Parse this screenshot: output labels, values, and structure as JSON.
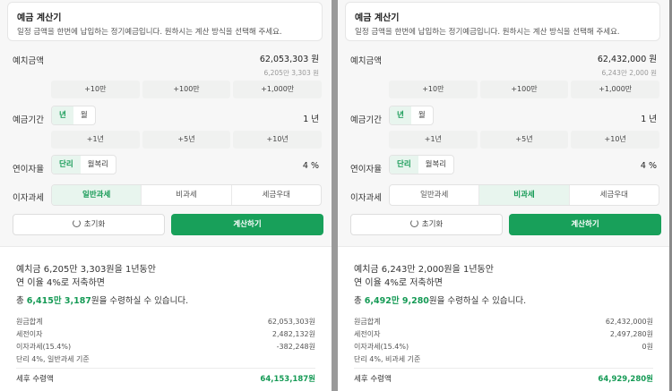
{
  "panels": [
    {
      "title": "예금 계산기",
      "subtitle": "일정 금액을 한번에 납입하는 정기예금입니다. 원하시는 계산 방식을 선택해 주세요.",
      "deposit_label": "예치금액",
      "deposit_value": "62,053,303 원",
      "deposit_sub": "6,205만 3,303 원",
      "deposit_buttons": [
        "+10만",
        "+100만",
        "+1,000만"
      ],
      "period_label": "예금기간",
      "period_options": [
        "년",
        "월"
      ],
      "period_value": "1 년",
      "period_buttons": [
        "+1년",
        "+5년",
        "+10년"
      ],
      "rate_label": "연이자율",
      "rate_options": [
        "단리",
        "월복리"
      ],
      "rate_value": "4 %",
      "tax_label": "이자과세",
      "tax_options": [
        "일반과세",
        "비과세",
        "세금우대"
      ],
      "tax_selected": 0,
      "reset_label": "초기화",
      "calc_label": "계산하기",
      "result_line1": "예치금 6,205만 3,303원을 1년동안",
      "result_line2": "연 이율 4%로 저축하면",
      "result_total_prefix": "총 ",
      "result_total_amount": "6,415만 3,187",
      "result_total_suffix": "원을 수령하실 수 있습니다.",
      "details": [
        {
          "label": "원금합계",
          "value": "62,053,303원"
        },
        {
          "label": "세전이자",
          "value": "2,482,132원"
        },
        {
          "label": "이자과세(15.4%)",
          "value": "-382,248원"
        },
        {
          "label": "단리 4%, 일반과세 기준",
          "value": ""
        }
      ],
      "final_label": "세후 수령액",
      "final_value": "64,153,187원"
    },
    {
      "title": "예금 계산기",
      "subtitle": "일정 금액을 한번에 납입하는 정기예금입니다. 원하시는 계산 방식을 선택해 주세요.",
      "deposit_label": "예치금액",
      "deposit_value": "62,432,000 원",
      "deposit_sub": "6,243만 2,000 원",
      "deposit_buttons": [
        "+10만",
        "+100만",
        "+1,000만"
      ],
      "period_label": "예금기간",
      "period_options": [
        "년",
        "월"
      ],
      "period_value": "1 년",
      "period_buttons": [
        "+1년",
        "+5년",
        "+10년"
      ],
      "rate_label": "연이자율",
      "rate_options": [
        "단리",
        "월복리"
      ],
      "rate_value": "4 %",
      "tax_label": "이자과세",
      "tax_options": [
        "일반과세",
        "비과세",
        "세금우대"
      ],
      "tax_selected": 1,
      "reset_label": "초기화",
      "calc_label": "계산하기",
      "result_line1": "예치금 6,243만 2,000원을 1년동안",
      "result_line2": "연 이율 4%로 저축하면",
      "result_total_prefix": "총 ",
      "result_total_amount": "6,492만 9,280",
      "result_total_suffix": "원을 수령하실 수 있습니다.",
      "details": [
        {
          "label": "원금합계",
          "value": "62,432,000원"
        },
        {
          "label": "세전이자",
          "value": "2,497,280원"
        },
        {
          "label": "이자과세(15.4%)",
          "value": "0원"
        },
        {
          "label": "단리 4%, 비과세 기준",
          "value": ""
        }
      ],
      "final_label": "세후 수령액",
      "final_value": "64,929,280원"
    }
  ],
  "colors": {
    "accent": "#18a05a",
    "accent_text": "#159a55",
    "selected_bg": "#e8f5ee"
  },
  "icons": {
    "reset": "refresh-icon"
  }
}
